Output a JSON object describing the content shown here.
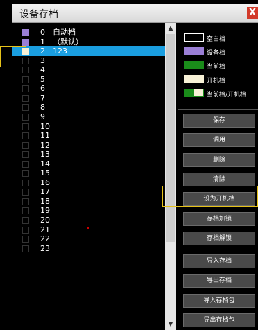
{
  "window": {
    "title": "设备存档",
    "close_label": "X"
  },
  "list": {
    "items": [
      {
        "index": "0",
        "name": "自动档",
        "color": "#9b7fd6"
      },
      {
        "index": "1",
        "name": "（默认）",
        "color": "#9b7fd6"
      },
      {
        "index": "2",
        "name": "123",
        "color": "#f7f1d6",
        "selected": true
      },
      {
        "index": "3",
        "name": ""
      },
      {
        "index": "4",
        "name": ""
      },
      {
        "index": "5",
        "name": ""
      },
      {
        "index": "6",
        "name": ""
      },
      {
        "index": "7",
        "name": ""
      },
      {
        "index": "8",
        "name": ""
      },
      {
        "index": "9",
        "name": ""
      },
      {
        "index": "10",
        "name": ""
      },
      {
        "index": "11",
        "name": ""
      },
      {
        "index": "12",
        "name": ""
      },
      {
        "index": "13",
        "name": ""
      },
      {
        "index": "14",
        "name": ""
      },
      {
        "index": "15",
        "name": ""
      },
      {
        "index": "16",
        "name": ""
      },
      {
        "index": "17",
        "name": ""
      },
      {
        "index": "18",
        "name": ""
      },
      {
        "index": "19",
        "name": ""
      },
      {
        "index": "20",
        "name": ""
      },
      {
        "index": "21",
        "name": ""
      },
      {
        "index": "22",
        "name": ""
      },
      {
        "index": "23",
        "name": ""
      }
    ]
  },
  "legend": [
    {
      "label": "空白档",
      "color": "#000000",
      "border": "#ffffff"
    },
    {
      "label": "设备档",
      "color": "#9b7fd6",
      "border": "#9b7fd6"
    },
    {
      "label": "当前档",
      "color": "#1a8c1a",
      "border": "#1a8c1a"
    },
    {
      "label": "开机档",
      "color": "#f7f1d6",
      "border": "#f7f1d6"
    },
    {
      "label": "当前档/开机档",
      "color": "#1a8c1a",
      "border": "#1a8c1a",
      "split": true
    }
  ],
  "buttons": {
    "group1": [
      "保存",
      "调用",
      "删除",
      "清除",
      "设为开机档",
      "存档加锁",
      "存档解锁"
    ],
    "group2": [
      "导入存档",
      "导出存档",
      "导入存档包",
      "导出存档包"
    ]
  },
  "scrollbar": {
    "up": "▲",
    "down": "▼"
  }
}
